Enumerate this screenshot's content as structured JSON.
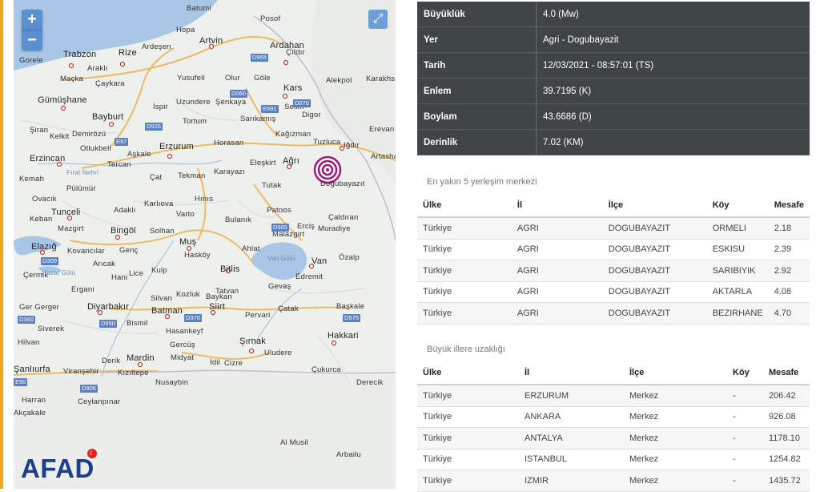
{
  "map": {
    "zoom_in": "+",
    "zoom_out": "−",
    "fullscreen": "⤢",
    "logo": "AFAD",
    "lake": "Van Gölü",
    "labels": [
      "Batumi",
      "Posof",
      "Hopa",
      "Artvin",
      "Ardahan",
      "Çıldır",
      "Gorele",
      "Trabzon",
      "Araklı",
      "Rize",
      "Ardeşen",
      "Yusufeli",
      "Olur",
      "Göle",
      "Kars",
      "Alekpol",
      "Karakhs",
      "Maçka",
      "Çaykara",
      "Uzundere",
      "Şenkaya",
      "Selim",
      "Digor",
      "Gümüşhane",
      "İspir",
      "Tortum",
      "Sarıkamış",
      "Kağızman",
      "Erevan",
      "Bayburt",
      "Tuzluca",
      "Iğdır",
      "Şiran",
      "Kelkit",
      "Demirözü",
      "Horasan",
      "Artashat",
      "Otlukbeli",
      "Aşkale",
      "Erzurum",
      "Eleşkirt",
      "Ağrı",
      "Erzincan",
      "Tercan",
      "Tutak",
      "Doğubayazıt",
      "Kemah",
      "Çat",
      "Tekman",
      "Karayazı",
      "Hınıs",
      "Patnos",
      "Ovacık",
      "Pülümür",
      "Karlıova",
      "Varto",
      "Çaldıran",
      "Tunceli",
      "Adaklı",
      "Bulanık",
      "Malazgirt",
      "Erciş",
      "Muradiye",
      "Mazgirt",
      "Bingöl",
      "Solhan",
      "Muş",
      "Ahlat",
      "Elazığ",
      "Kovancılar",
      "Genç",
      "Hasköy",
      "Bitlis",
      "Van",
      "Özalp",
      "Arıcak",
      "Hani",
      "Lice",
      "Kulp",
      "Edremit",
      "Ergani",
      "Kozluk",
      "Tatvan",
      "Gevaş",
      "Diyarbakır",
      "Silvan",
      "Baykan",
      "Siirt",
      "Pervari",
      "Çatak",
      "Başkale",
      "Ger Gerger",
      "Bismil",
      "Batman",
      "Hasankeyf",
      "Siverek",
      "Gercüş",
      "Şırnak",
      "Hakkari",
      "Hilvan",
      "Mardin",
      "Derik",
      "Midyat",
      "Uludere",
      "Kızıltepe",
      "İdil",
      "Cizre",
      "Çukurca",
      "Şanlıurfa",
      "Viranşehir",
      "Nusaybin",
      "Derecik",
      "Harran",
      "Ceylanpınar",
      "Akçakale",
      "Al Musil",
      "Arbailu",
      "Çermik",
      "Keban",
      "Fırat Nehri",
      "Hazar Gölü"
    ],
    "road_shields": [
      "D955",
      "D060",
      "E691",
      "D070",
      "D925",
      "E97",
      "D965",
      "D300",
      "D950",
      "D370",
      "D975",
      "D360",
      "D905",
      "E90"
    ]
  },
  "quake": {
    "rows": [
      {
        "label": "Büyüklük",
        "value": "4.0 (Mw)"
      },
      {
        "label": "Yer",
        "value": "Agri - Dogubayazit"
      },
      {
        "label": "Tarih",
        "value": "12/03/2021 - 08:57:01 (TS)"
      },
      {
        "label": "Enlem",
        "value": "39.7195 (K)"
      },
      {
        "label": "Boylam",
        "value": "43.6686 (D)"
      },
      {
        "label": "Derinlik",
        "value": "7.02 (KM)"
      }
    ]
  },
  "nearest": {
    "title": "En yakın 5 yerleşim merkezi",
    "headers": [
      "Ülke",
      "İl",
      "İlçe",
      "Köy",
      "Mesafe"
    ],
    "rows": [
      [
        "Türkiye",
        "AGRI",
        "DOGUBAYAZIT",
        "ORMELI",
        "2.18"
      ],
      [
        "Türkiye",
        "AGRI",
        "DOGUBAYAZIT",
        "ESKISU",
        "2.39"
      ],
      [
        "Türkiye",
        "AGRI",
        "DOGUBAYAZIT",
        "SARIBIYIK",
        "2.92"
      ],
      [
        "Türkiye",
        "AGRI",
        "DOGUBAYAZIT",
        "AKTARLA",
        "4.08"
      ],
      [
        "Türkiye",
        "AGRI",
        "DOGUBAYAZIT",
        "BEZIRHANE",
        "4.70"
      ]
    ]
  },
  "cities": {
    "title": "Büyük illere uzaklığı",
    "headers": [
      "Ülke",
      "İl",
      "İlçe",
      "Köy",
      "Mesafe"
    ],
    "rows": [
      [
        "Türkiye",
        "ERZURUM",
        "Merkez",
        "-",
        "206.42"
      ],
      [
        "Türkiye",
        "ANKARA",
        "Merkez",
        "-",
        "926.08"
      ],
      [
        "Türkiye",
        "ANTALYA",
        "Merkez",
        "-",
        "1178.10"
      ],
      [
        "Türkiye",
        "ISTANBUL",
        "Merkez",
        "-",
        "1254.82"
      ],
      [
        "Türkiye",
        "IZMIR",
        "Merkez",
        "-",
        "1435.72"
      ]
    ]
  },
  "colors": {
    "accent": "#f2a81d",
    "header_bg": "#3f4447",
    "epicenter": "#a3167e",
    "logo": "#1c3f8c"
  }
}
